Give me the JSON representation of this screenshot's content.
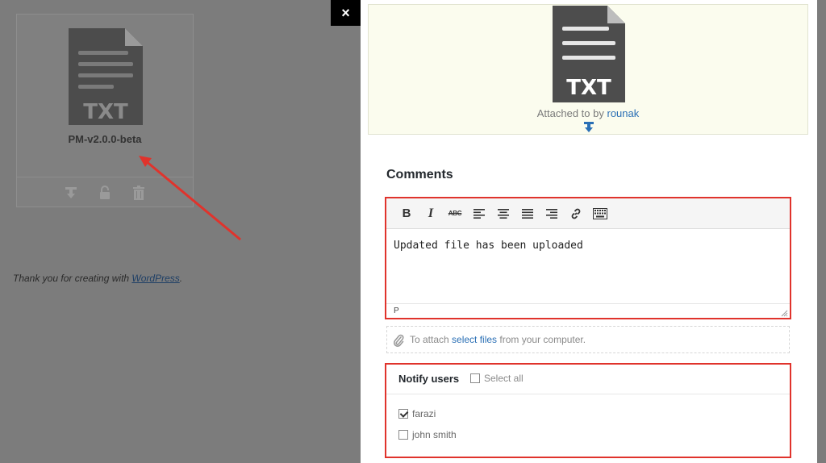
{
  "background": {
    "file_card": {
      "title": "PM-v2.0.0-beta",
      "icon_label": "TXT",
      "actions": [
        "download-icon",
        "lock-icon",
        "trash-icon"
      ]
    },
    "footer": {
      "prefix": "Thank you for creating with ",
      "link": "WordPress",
      "suffix": "."
    }
  },
  "modal": {
    "close_label": "×",
    "preview": {
      "icon_label": "TXT",
      "attached_prefix": "Attached to by ",
      "attached_user": "rounak"
    },
    "comments": {
      "title": "Comments",
      "toolbar": {
        "bold": "B",
        "italic": "I",
        "strikethrough": "ABC"
      },
      "body": "Updated file has been uploaded",
      "path": "P"
    },
    "attach": {
      "prefix": "To attach ",
      "link": "select files",
      "suffix": " from your computer."
    },
    "notify": {
      "title": "Notify users",
      "select_all": "Select all",
      "users": [
        {
          "name": "farazi",
          "checked": true
        },
        {
          "name": "john smith",
          "checked": false
        }
      ]
    }
  },
  "colors": {
    "highlight": "#e0332c",
    "link": "#2a6fb5",
    "preview_bg": "#fbfcee"
  }
}
